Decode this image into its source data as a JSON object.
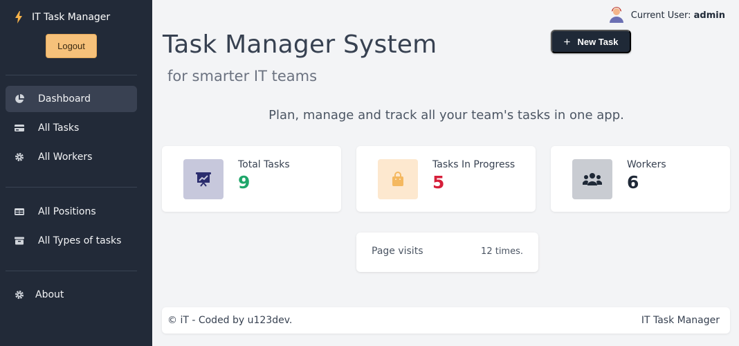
{
  "sidebar": {
    "brand": "IT Task Manager",
    "logout_label": "Logout",
    "items": [
      {
        "label": "Dashboard",
        "icon": "pie-chart-icon"
      },
      {
        "label": "All Tasks",
        "icon": "card-icon"
      },
      {
        "label": "All Workers",
        "icon": "gear-icon"
      },
      {
        "label": "All Positions",
        "icon": "table-icon"
      },
      {
        "label": "All Types of tasks",
        "icon": "archive-icon"
      },
      {
        "label": "About",
        "icon": "gear-icon"
      }
    ]
  },
  "header": {
    "user_prefix": "Current User:",
    "user_name": "admin",
    "title": "Task Manager System",
    "subtitle": "for smarter IT teams",
    "new_task_label": "New Task"
  },
  "tagline": "Plan, manage and track all your team's tasks in one app.",
  "cards": [
    {
      "label": "Total Tasks",
      "value": "9",
      "value_color": "#1fa66a",
      "icon": "presentation-chart-icon",
      "icon_bg": "#c7c8dc"
    },
    {
      "label": "Tasks In Progress",
      "value": "5",
      "value_color": "#d61f3a",
      "icon": "shopping-bag-icon",
      "icon_bg": "#fde8cf"
    },
    {
      "label": "Workers",
      "value": "6",
      "value_color": "#1f2937",
      "icon": "users-icon",
      "icon_bg": "#c9ccd2"
    }
  ],
  "visits": {
    "label": "Page visits",
    "value": "12 times."
  },
  "footer": {
    "left": "© iT - Coded by u123dev.",
    "right": "IT Task Manager"
  }
}
